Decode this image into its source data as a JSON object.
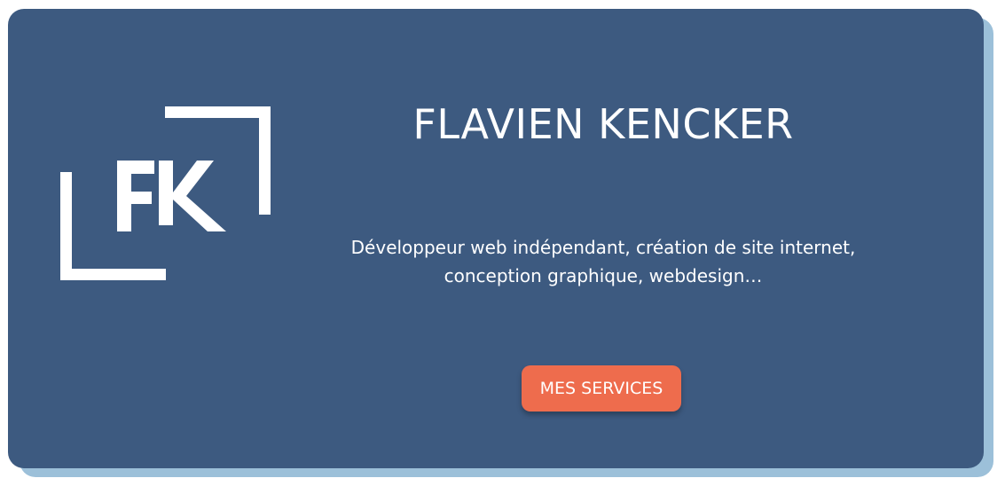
{
  "logo": {
    "monogram": "FK"
  },
  "hero": {
    "title": "FLAVIEN KENCKER",
    "tagline_line1": "Développeur web indépendant, création de site internet,",
    "tagline_line2": "conception graphique, webdesign…",
    "cta_label": "MES SERVICES"
  },
  "colors": {
    "card_background": "#3d5a80",
    "card_shadow": "#9cc0d9",
    "cta_background": "#ee6c4d",
    "text": "#ffffff"
  }
}
